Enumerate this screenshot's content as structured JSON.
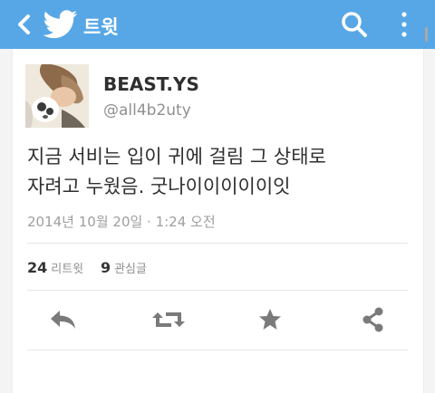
{
  "header": {
    "title": "트윗",
    "back_icon": "chevron-left-icon",
    "logo_icon": "twitter-bird-icon",
    "search_icon": "search-icon",
    "menu_icon": "more-vertical-icon",
    "bg_color": "#57a7e6"
  },
  "tweet": {
    "display_name": "BEAST.YS",
    "handle": "@all4b2uty",
    "text": "지금 서비는 입이 귀에 걸림 그 상태로\n자려고 누웠음. 굿나이이이이이잇",
    "timestamp": "2014년 10월 20일 · 1:24 오전"
  },
  "stats": {
    "retweets_count": "24",
    "retweets_label": "리트윗",
    "favorites_count": "9",
    "favorites_label": "관심글"
  },
  "actions": [
    "reply-icon",
    "retweet-icon",
    "star-icon",
    "share-icon"
  ]
}
